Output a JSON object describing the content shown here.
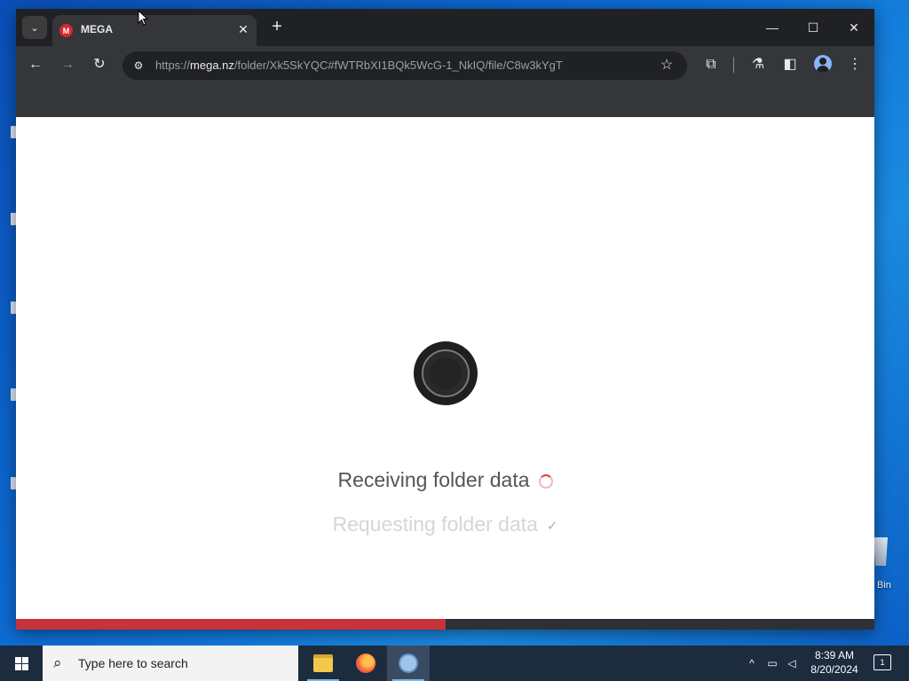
{
  "browser": {
    "tab_title": "MEGA",
    "favicon_letter": "M",
    "url_prefix": "https://",
    "url_host": "mega.nz",
    "url_path": "/folder/Xk5SkYQC#fWTRbXI1BQk5WcG-1_NkIQ/file/C8w3kYgT"
  },
  "page": {
    "status_primary": "Receiving folder data",
    "status_secondary": "Requesting folder data",
    "progress_fraction": 0.5
  },
  "icons": {
    "tab_search": "⌄",
    "tab_close": "✕",
    "new_tab": "+",
    "minimize": "—",
    "maximize": "☐",
    "close": "✕",
    "back": "←",
    "forward": "→",
    "reload": "↻",
    "site_info": "⚙",
    "star": "☆",
    "extensions": "⧉",
    "labs": "⚗",
    "side_panel": "◧",
    "menu": "⋮",
    "check": "✓",
    "search": "⌕"
  },
  "desktop": {
    "recycle_bin_label": "Bin"
  },
  "taskbar": {
    "search_placeholder": "Type here to search",
    "time": "8:39 AM",
    "date": "8/20/2024",
    "notification_count": "1"
  },
  "colors": {
    "mega_red": "#d9272e",
    "progress_red": "#c8323a"
  }
}
